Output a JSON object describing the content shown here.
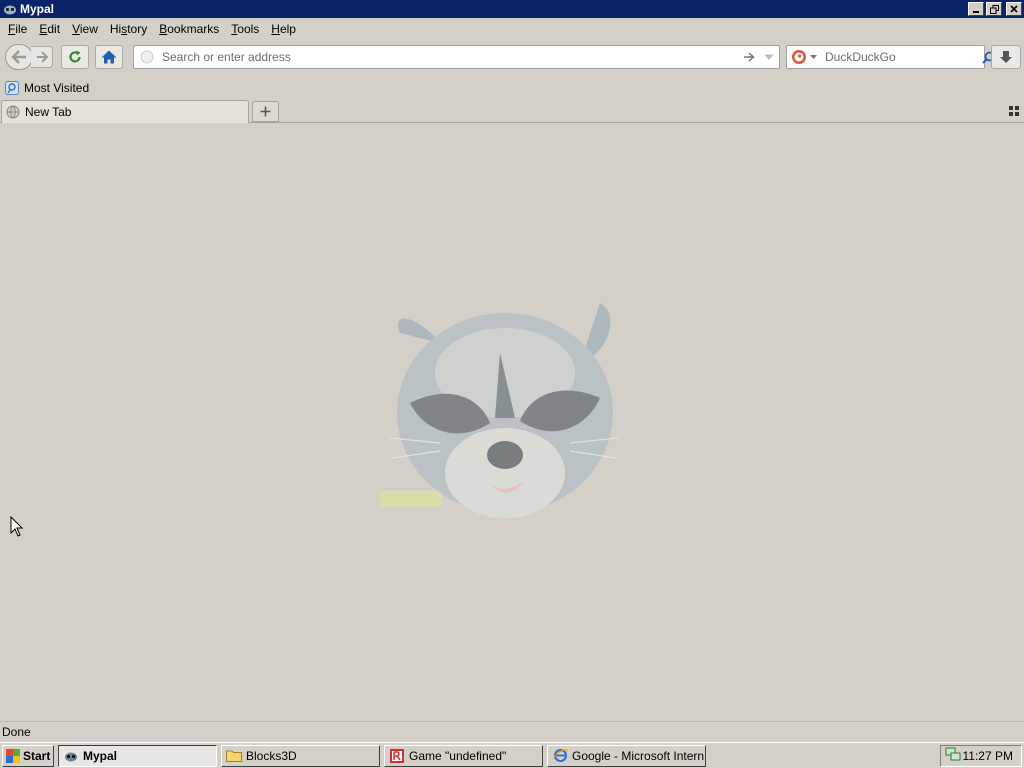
{
  "window": {
    "title": "Mypal"
  },
  "menu": [
    "File",
    "Edit",
    "View",
    "History",
    "Bookmarks",
    "Tools",
    "Help"
  ],
  "menu_mnemonics": [
    "F",
    "E",
    "V",
    "s",
    "B",
    "T",
    "H"
  ],
  "navbar": {
    "address_placeholder": "Search or enter address",
    "search_placeholder": "DuckDuckGo"
  },
  "bookmarks": {
    "most_visited": "Most Visited"
  },
  "tabs": [
    {
      "label": "New Tab"
    }
  ],
  "status": {
    "text": "Done"
  },
  "taskbar": {
    "start": "Start",
    "tasks": [
      {
        "label": "Mypal",
        "active": true
      },
      {
        "label": "Blocks3D",
        "active": false
      },
      {
        "label": "Game \"undefined\"",
        "active": false
      },
      {
        "label": "Google - Microsoft Intern...",
        "active": false
      }
    ],
    "clock": "11:27 PM"
  },
  "colors": {
    "titlebar": "#0a246a",
    "chrome": "#d4d0c8",
    "home_blue": "#1f5fb7",
    "reload_green": "#2e8b2e"
  }
}
